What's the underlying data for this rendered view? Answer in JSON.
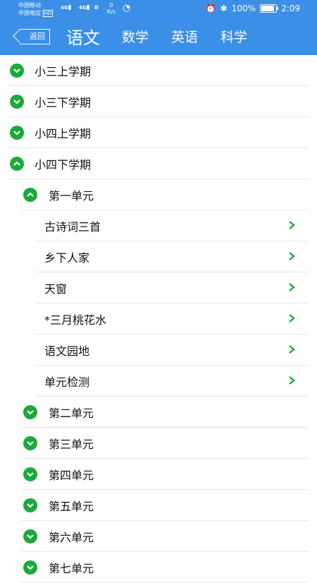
{
  "status": {
    "carrier1": "中国移动",
    "carrier2": "中国电信",
    "hd": "HD",
    "net1": "4G",
    "net2": "4G",
    "speed": "0",
    "speed_unit": "K/s",
    "battery_text": "100%",
    "battery_level": 1.0,
    "time": "2:09"
  },
  "header": {
    "back_label": "返回",
    "tabs": [
      {
        "label": "语文",
        "active": true
      },
      {
        "label": "数学",
        "active": false
      },
      {
        "label": "英语",
        "active": false
      },
      {
        "label": "科学",
        "active": false
      }
    ]
  },
  "colors": {
    "primary": "#3b8fe6",
    "accent_green": "#1aaa3a",
    "divider": "#e6e6e6"
  },
  "list": {
    "semesters": [
      {
        "label": "小三上学期",
        "expanded": false
      },
      {
        "label": "小三下学期",
        "expanded": false
      },
      {
        "label": "小四上学期",
        "expanded": false
      },
      {
        "label": "小四下学期",
        "expanded": true
      }
    ],
    "units": [
      {
        "label": "第一单元",
        "expanded": true
      },
      {
        "label": "第二单元",
        "expanded": false
      },
      {
        "label": "第三单元",
        "expanded": false
      },
      {
        "label": "第四单元",
        "expanded": false
      },
      {
        "label": "第五单元",
        "expanded": false
      },
      {
        "label": "第六单元",
        "expanded": false
      },
      {
        "label": "第七单元",
        "expanded": false
      }
    ],
    "lessons": [
      {
        "label": "古诗词三首"
      },
      {
        "label": "乡下人家"
      },
      {
        "label": "天窗"
      },
      {
        "label": "*三月桃花水"
      },
      {
        "label": "语文园地"
      },
      {
        "label": "单元检测"
      }
    ]
  }
}
